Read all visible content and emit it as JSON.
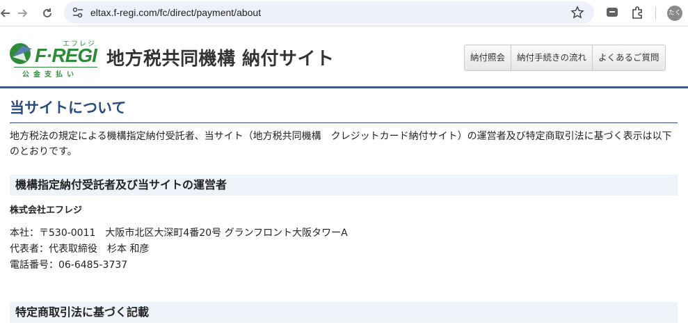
{
  "browser": {
    "url": "eltax.f-regi.com/fc/direct/payment/about",
    "profile_label": "たく"
  },
  "header": {
    "logo_text": "F·REGI",
    "logo_kana": "エフレジ",
    "logo_sub": "公金支払い",
    "site_title": "地方税共同機構 納付サイト",
    "nav": [
      "納付照会",
      "納付手続きの流れ",
      "よくあるご質問"
    ]
  },
  "main": {
    "page_title": "当サイトについて",
    "intro": "地方税法の規定による機構指定納付受託者、当サイト（地方税共同機構　クレジットカード納付サイト）の運営者及び特定商取引法に基づく表示は以下のとおりです。",
    "section1": {
      "heading": "機構指定納付受託者及び当サイトの運営者",
      "company": "株式会社エフレジ",
      "lines": [
        "本社：〒530-0011　大阪市北区大深町4番20号 グランフロント大阪タワーA",
        "代表者：代表取締役　杉本 和彦",
        "電話番号：06-6485-3737"
      ]
    },
    "section2": {
      "heading": "特定商取引法に基づく記載"
    }
  },
  "colors": {
    "accent": "#2b4a7f",
    "logo_green": "#2e8b3a",
    "section_bg": "#eef3fa"
  }
}
